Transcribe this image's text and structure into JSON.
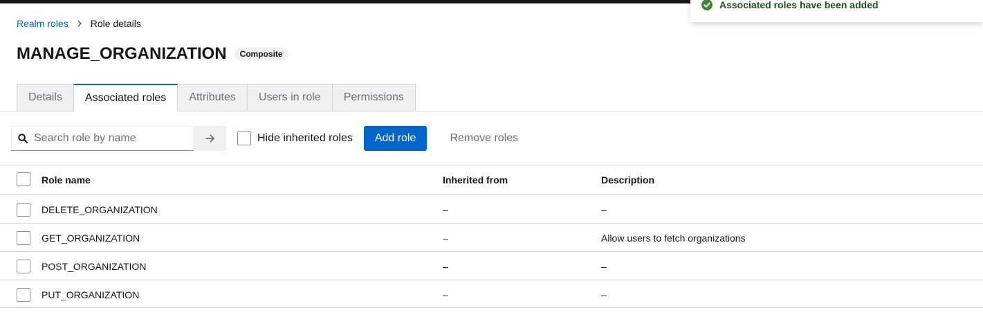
{
  "toast": {
    "title": "Associated roles have been added",
    "color": "#3e8635"
  },
  "breadcrumb": {
    "parent": "Realm roles",
    "current": "Role details"
  },
  "role": {
    "name": "MANAGE_ORGANIZATION",
    "badge": "Composite"
  },
  "tabs": [
    {
      "label": "Details"
    },
    {
      "label": "Associated roles"
    },
    {
      "label": "Attributes"
    },
    {
      "label": "Users in role"
    },
    {
      "label": "Permissions"
    }
  ],
  "toolbar": {
    "search_placeholder": "Search role by name",
    "search_value": "",
    "hide_inherited_label": "Hide inherited roles",
    "add_role_label": "Add role",
    "remove_roles_label": "Remove roles"
  },
  "table": {
    "columns": {
      "name": "Role name",
      "inherited": "Inherited from",
      "description": "Description"
    },
    "rows": [
      {
        "name": "DELETE_ORGANIZATION",
        "inherited": "–",
        "description": "–"
      },
      {
        "name": "GET_ORGANIZATION",
        "inherited": "–",
        "description": "Allow users to fetch organizations"
      },
      {
        "name": "POST_ORGANIZATION",
        "inherited": "–",
        "description": "–"
      },
      {
        "name": "PUT_ORGANIZATION",
        "inherited": "–",
        "description": "–"
      }
    ]
  },
  "colors": {
    "accent": "#0066cc",
    "success": "#3e8635"
  }
}
